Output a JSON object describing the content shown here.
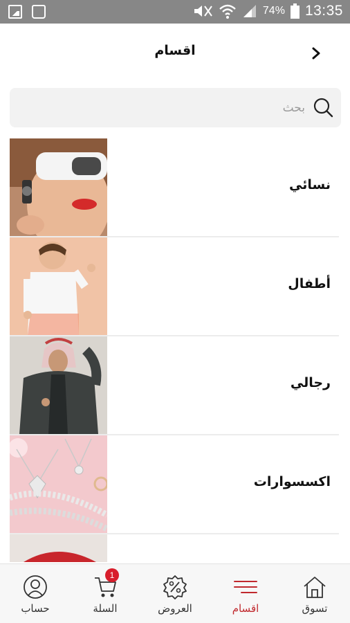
{
  "status_bar": {
    "battery": "74%",
    "time": "13:35"
  },
  "header": {
    "title": "اقسام"
  },
  "search": {
    "placeholder": "بحث"
  },
  "categories": [
    {
      "label": "نسائي"
    },
    {
      "label": "أطفال"
    },
    {
      "label": "رجالي"
    },
    {
      "label": "اكسسوارات"
    }
  ],
  "bottom_nav": {
    "items": [
      {
        "label": "تسوق",
        "icon": "home-icon"
      },
      {
        "label": "اقسام",
        "icon": "menu-icon",
        "active": true
      },
      {
        "label": "العروض",
        "icon": "discount-icon"
      },
      {
        "label": "السلة",
        "icon": "cart-icon",
        "badge": "1"
      },
      {
        "label": "حساب",
        "icon": "user-icon"
      }
    ]
  },
  "colors": {
    "accent": "#c0282d",
    "badge": "#d81e2c",
    "status_bar": "#878787",
    "search_bg": "#f2f2f2"
  }
}
